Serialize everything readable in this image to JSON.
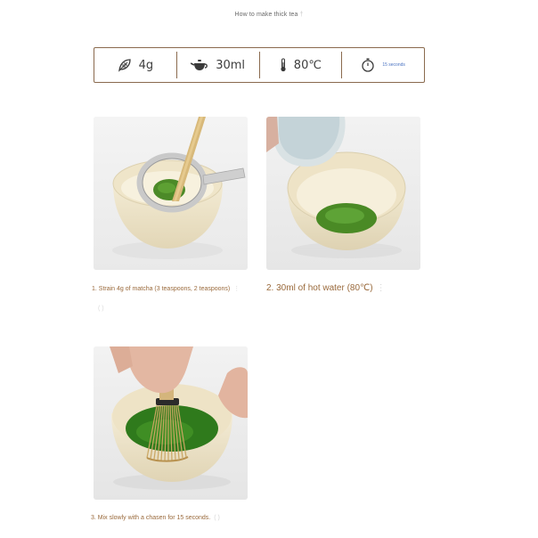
{
  "page": {
    "title": "How to make thick tea",
    "title_mark": "†"
  },
  "spec": {
    "matcha": "4g",
    "water": "30ml",
    "temperature": "80℃",
    "time": "15 seconds",
    "icons": [
      "leaf-icon",
      "teapot-icon",
      "thermometer-icon",
      "timer-icon"
    ]
  },
  "steps": [
    {
      "caption": "1. Strain 4g of matcha (3 teaspoons, 2 teaspoons)",
      "mark": "⋮",
      "extra": "(   )"
    },
    {
      "caption": "2. 30ml of hot water (80℃)",
      "mark": "⋮"
    },
    {
      "caption": "3. Mix slowly with a chasen for 15 seconds.",
      "mark": "( )"
    }
  ],
  "colors": {
    "accent_brown": "#8a6a4e",
    "caption": "#9a6a3c",
    "matcha_green": "#4f8a2b",
    "bowl_cream": "#efe6cf"
  }
}
